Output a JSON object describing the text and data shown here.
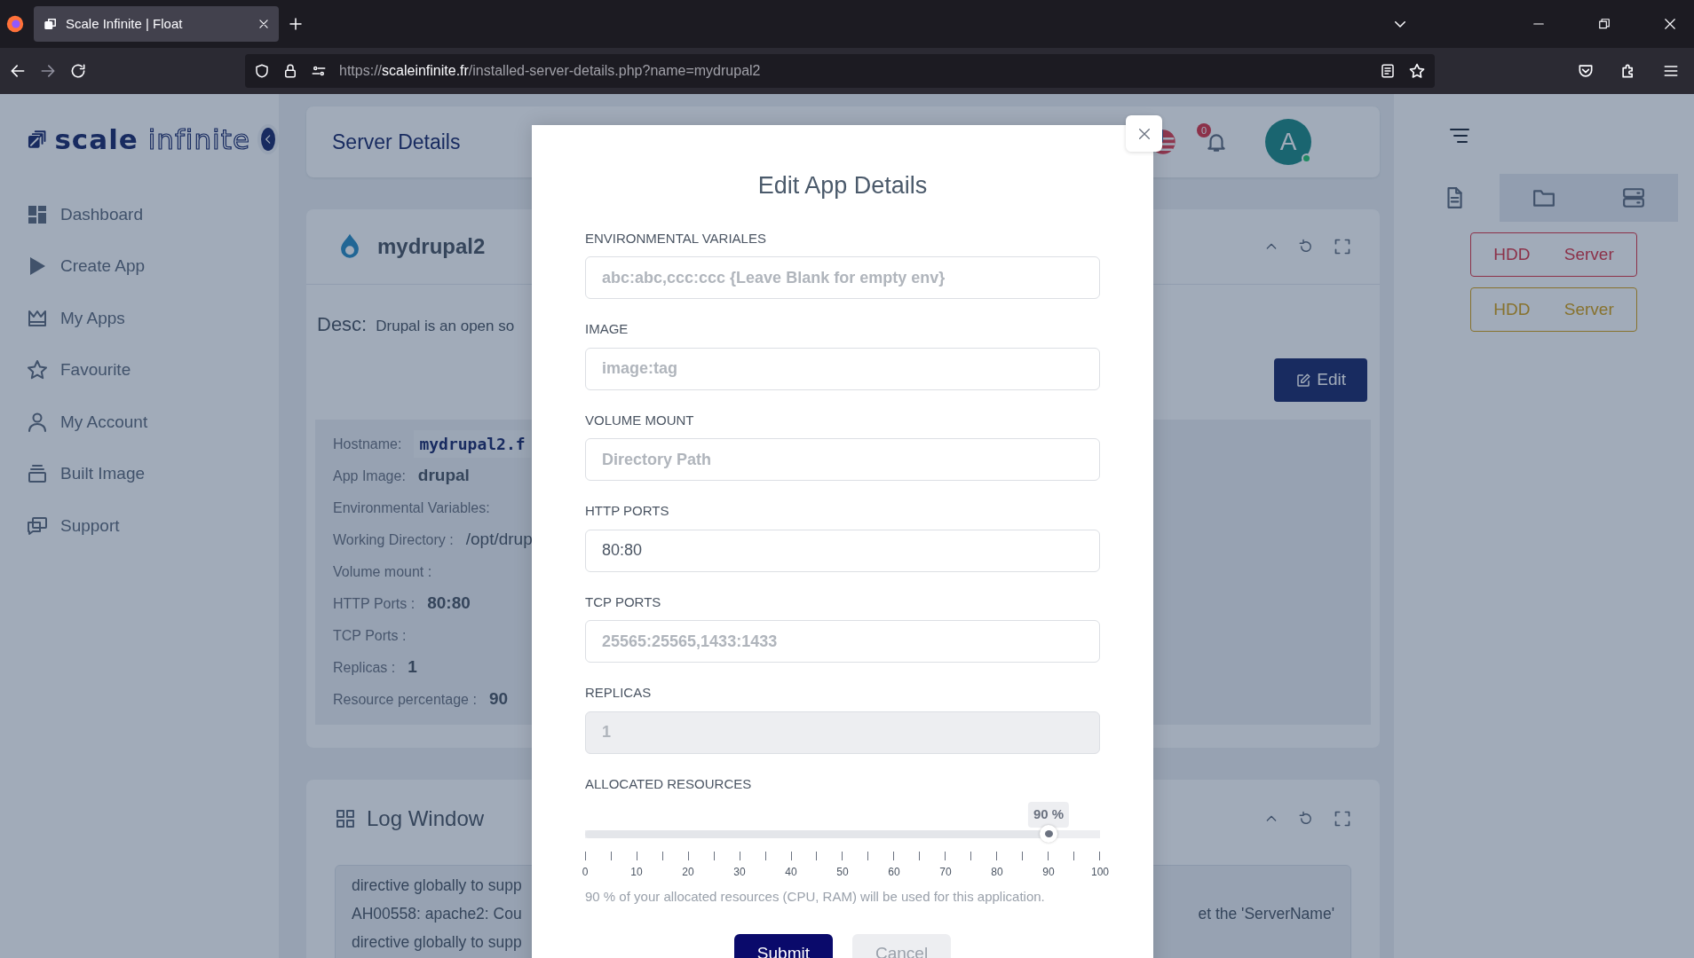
{
  "browser": {
    "tab_title": "Scale Infinite | Float",
    "url_scheme": "https://",
    "url_host": "scaleinfinite.fr",
    "url_path": "/installed-server-details.php?name=mydrupal2"
  },
  "sidebar": {
    "logo_bold": "scale",
    "logo_outline": "infinite",
    "items": [
      {
        "label": "Dashboard"
      },
      {
        "label": "Create App"
      },
      {
        "label": "My Apps"
      },
      {
        "label": "Favourite"
      },
      {
        "label": "My Account"
      },
      {
        "label": "Built Image"
      },
      {
        "label": "Support"
      }
    ]
  },
  "header": {
    "title": "Server Details",
    "notification_count": "0",
    "avatar_letter": "A"
  },
  "app_card": {
    "name": "mydrupal2",
    "desc_label": "Desc:",
    "desc": "Drupal is an open so",
    "edit_button": "Edit",
    "details": [
      {
        "label": "Hostname:",
        "value": "mydrupal2.f",
        "kind": "code"
      },
      {
        "label": "App Image:",
        "value": "drupal",
        "kind": "bold"
      },
      {
        "label": "Environmental Variables:"
      },
      {
        "label": "Working Directory :",
        "value": "/opt/drup",
        "kind": "plain"
      },
      {
        "label": "Volume mount :"
      },
      {
        "label": "HTTP Ports :",
        "value": "80:80",
        "kind": "bold"
      },
      {
        "label": "TCP Ports :"
      },
      {
        "label": "Replicas :",
        "value": "1",
        "kind": "bold"
      },
      {
        "label": "Resource percentage :",
        "value": "90",
        "kind": "bold"
      }
    ]
  },
  "log_window": {
    "title": "Log Window",
    "lines": [
      {
        "left": "directive globally to supp"
      },
      {
        "left": "AH00558: apache2: Cou",
        "right": "et the 'ServerName'"
      },
      {
        "left": "directive globally to supp"
      }
    ]
  },
  "right_panel": {
    "tabs": [
      {
        "selected": true
      },
      {
        "selected": false
      },
      {
        "selected": false
      }
    ],
    "storage_buttons": [
      {
        "left": "HDD",
        "right": "Server",
        "kind": "danger"
      },
      {
        "left": "HDD",
        "right": "Server",
        "kind": "warning"
      }
    ]
  },
  "modal": {
    "title": "Edit App Details",
    "fields": [
      {
        "label": "ENVIRONMENTAL VARIALES",
        "placeholder": "abc:abc,ccc:ccc {Leave Blank for empty env}",
        "disabled": false
      },
      {
        "label": "IMAGE",
        "placeholder": "image:tag",
        "disabled": false
      },
      {
        "label": "VOLUME MOUNT",
        "placeholder": "Directory Path",
        "disabled": false
      },
      {
        "label": "HTTP PORTS",
        "value": "80:80",
        "disabled": false
      },
      {
        "label": "TCP PORTS",
        "placeholder": "25565:25565,1433:1433",
        "disabled": false
      },
      {
        "label": "REPLICAS",
        "value": "1",
        "disabled": true
      }
    ],
    "slider": {
      "label": "ALLOCATED RESOURCES",
      "level": 0.9,
      "bubble": "90 %",
      "ticks": [
        "0",
        "10",
        "20",
        "30",
        "40",
        "50",
        "60",
        "70",
        "80",
        "90",
        "100"
      ],
      "help": "90 % of your allocated resources (CPU, RAM) will be used for this application."
    },
    "buttons": [
      {
        "label": "Submit",
        "kind": "primary"
      },
      {
        "label": "Cancel",
        "kind": "secondary"
      }
    ]
  }
}
